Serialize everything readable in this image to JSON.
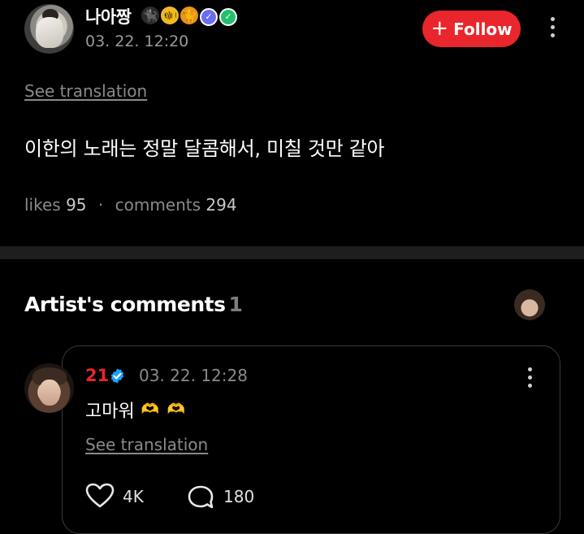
{
  "post": {
    "username": "나아짱",
    "name_emojis": [
      "🐈‍⬛",
      "🐠",
      "🐈"
    ],
    "date": "03. 22. 12:20",
    "follow_label": "Follow",
    "see_translation": "See translation",
    "body": "이한의 노래는 정말 달콤해서, 미칠 것만 같아",
    "likes_label": "likes",
    "likes_count": "95",
    "comments_label": "comments",
    "comments_count": "294"
  },
  "artist_comments": {
    "title": "Artist's comments",
    "count": "1",
    "comment": {
      "author": "21",
      "date": "03. 22. 12:28",
      "text": "고마워",
      "emoji": [
        "🫶",
        "🫶"
      ],
      "see_translation": "See translation",
      "likes": "4K",
      "replies": "180"
    }
  },
  "colors": {
    "background": "#000000",
    "accent_red": "#e8262b",
    "muted_text": "#8a8a8a",
    "verified_blue": "#1da1f2",
    "divider": "#1e1e1e"
  }
}
